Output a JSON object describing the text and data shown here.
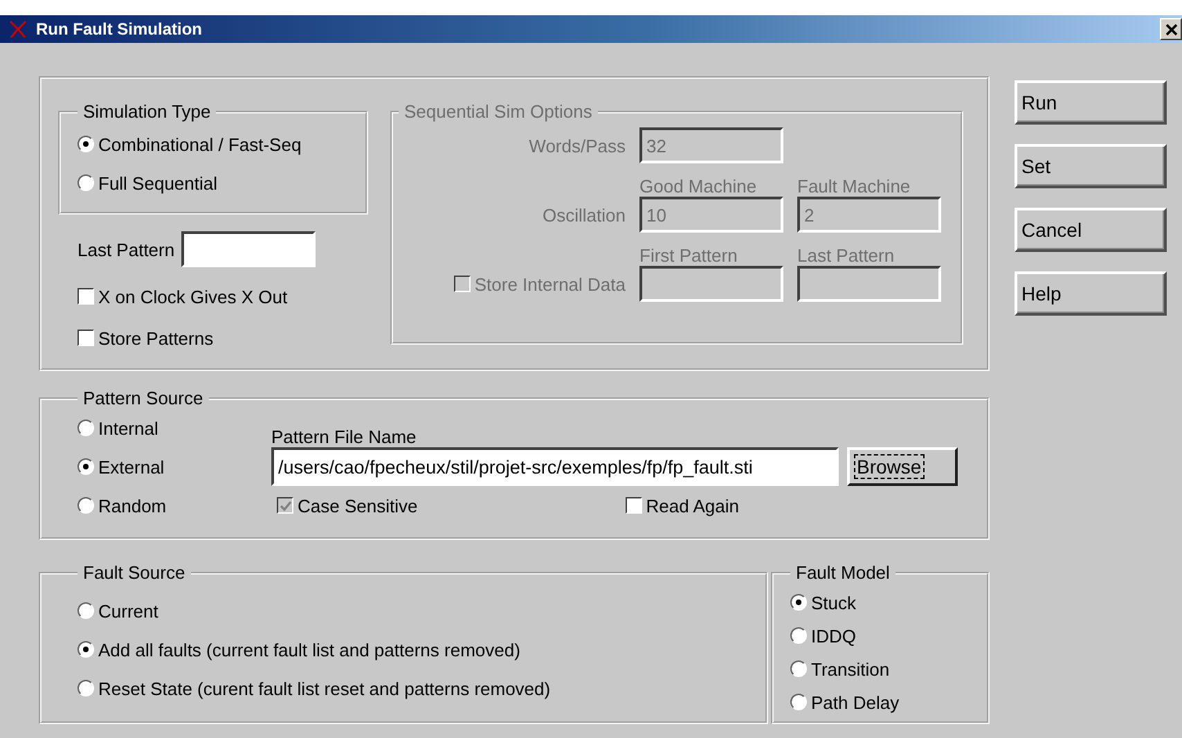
{
  "window": {
    "title": "Run Fault Simulation"
  },
  "simulation_type": {
    "title": "Simulation Type",
    "options": [
      {
        "label": "Combinational / Fast-Seq",
        "selected": true
      },
      {
        "label": "Full Sequential",
        "selected": false
      }
    ]
  },
  "last_pattern": {
    "label": "Last Pattern"
  },
  "options": [
    {
      "label": "X on Clock Gives X Out",
      "checked": false
    },
    {
      "label": "Store Patterns",
      "checked": false
    }
  ],
  "sequential_sim_options": {
    "title": "Sequential Sim Options",
    "disabled": true,
    "words_per_pass": {
      "label": "Words/Pass",
      "value": "32"
    },
    "oscillation": {
      "label": "Oscillation",
      "good_machine": {
        "label": "Good Machine",
        "value": "10"
      },
      "fault_machine": {
        "label": "Fault Machine",
        "value": "2"
      }
    },
    "store_internal_data": {
      "label": "Store Internal Data",
      "checked": false
    },
    "first_pattern": {
      "label": "First Pattern"
    },
    "last_pattern": {
      "label": "Last Pattern"
    }
  },
  "pattern_source": {
    "title": "Pattern Source",
    "options": [
      {
        "label": "Internal",
        "selected": false
      },
      {
        "label": "External",
        "selected": true
      },
      {
        "label": "Random",
        "selected": false
      }
    ],
    "file_name": {
      "label": "Pattern File Name",
      "value": "/users/cao/fpecheux/stil/projet-src/exemples/fp/fp_fault.sti"
    },
    "browse": {
      "label": "Browse",
      "focused": true
    },
    "case_sensitive": {
      "label": "Case Sensitive",
      "checked": true,
      "disabled": true
    },
    "read_again": {
      "label": "Read Again",
      "checked": false,
      "disabled": false
    }
  },
  "fault_source": {
    "title": "Fault Source",
    "options": [
      {
        "label": "Current",
        "selected": false
      },
      {
        "label": "Add all faults (current fault list and patterns removed)",
        "selected": true
      },
      {
        "label": "Reset State (curent fault list reset and patterns removed)",
        "selected": false
      }
    ]
  },
  "fault_model": {
    "title": "Fault Model",
    "options": [
      {
        "label": "Stuck",
        "selected": true
      },
      {
        "label": "IDDQ",
        "selected": false
      },
      {
        "label": "Transition",
        "selected": false
      },
      {
        "label": "Path Delay",
        "selected": false
      }
    ]
  },
  "buttons": [
    "Run",
    "Set",
    "Cancel",
    "Help"
  ]
}
